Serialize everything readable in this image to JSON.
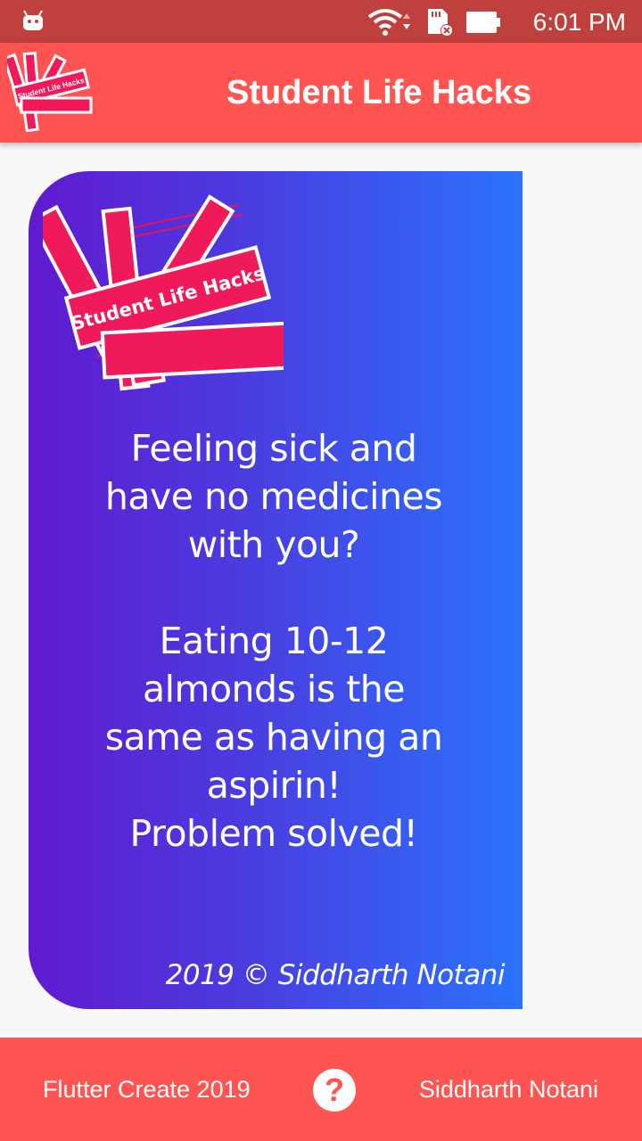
{
  "status_bar": {
    "time": "6:01 PM",
    "icons": [
      "android-icon",
      "wifi-icon",
      "sd-card-icon",
      "battery-icon"
    ]
  },
  "app_bar": {
    "logo_text": "Student Life Hacks",
    "title": "Student Life Hacks"
  },
  "card": {
    "logo_text": "Student Life Hacks",
    "hack_text": "Feeling sick and\nhave no medicines\nwith you?\n\nEating 10-12\nalmonds is the\nsame as having an\naspirin!\nProblem solved!",
    "credit": "2019 © Siddharth Notani",
    "gradient_start": "#6119cf",
    "gradient_end": "#2a73fb"
  },
  "bottom_bar": {
    "left_label": "Flutter Create 2019",
    "help_icon": "help-icon",
    "help_glyph": "?",
    "right_label": "Siddharth Notani"
  },
  "colors": {
    "accent": "#ff5552",
    "status_bar": "#c0403d",
    "logo_pink": "#f01a5a"
  }
}
